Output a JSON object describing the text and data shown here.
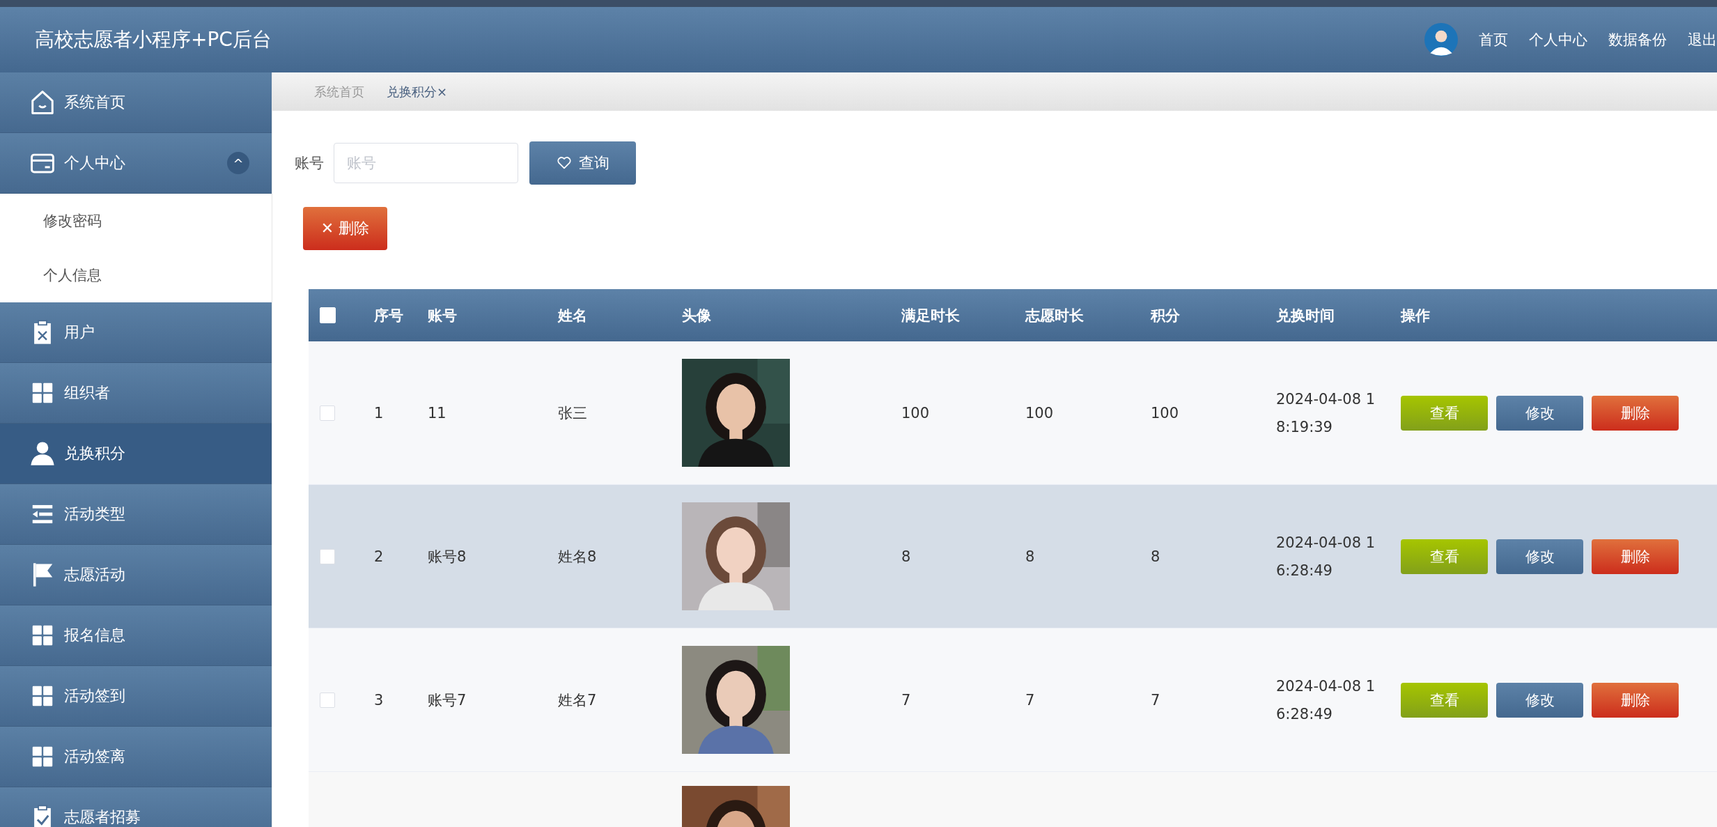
{
  "header": {
    "title": "高校志愿者小程序+PC后台",
    "nav": [
      "首页",
      "个人中心",
      "数据备份",
      "退出"
    ]
  },
  "sidebar": {
    "items": [
      {
        "label": "系统首页",
        "selected": false
      },
      {
        "label": "个人中心",
        "selected": false,
        "expanded": true,
        "toggle": "^",
        "children": [
          {
            "label": "修改密码",
            "selected": false
          },
          {
            "label": "个人信息",
            "selected": false
          }
        ]
      },
      {
        "label": "用户",
        "selected": false
      },
      {
        "label": "组织者",
        "selected": false
      },
      {
        "label": "兑换积分",
        "selected": true
      },
      {
        "label": "活动类型",
        "selected": false
      },
      {
        "label": "志愿活动",
        "selected": false
      },
      {
        "label": "报名信息",
        "selected": false
      },
      {
        "label": "活动签到",
        "selected": false
      },
      {
        "label": "活动签离",
        "selected": false
      },
      {
        "label": "志愿者招募",
        "selected": false
      }
    ]
  },
  "breadcrumb_tabs": [
    {
      "label": "系统首页",
      "selected": false
    },
    {
      "label": "兑换积分",
      "close": "×",
      "selected": true
    }
  ],
  "search": {
    "label": "账号",
    "placeholder": "账号",
    "button": "查询"
  },
  "delete_button": {
    "icon_char": "✕",
    "label": "删除"
  },
  "table": {
    "header_checked": false,
    "columns": [
      "序号",
      "账号",
      "姓名",
      "头像",
      "满足时长",
      "志愿时长",
      "积分",
      "兑换时间",
      "操作"
    ],
    "rows": [
      {
        "checked": false,
        "selected": false,
        "cells": [
          "1",
          "11",
          "张三"
        ],
        "avatar": {
          "kind": "picture"
        },
        "stats": [
          "100",
          "100",
          "100"
        ],
        "time": "2024-04-08 18:19:39",
        "actions": [
          "查看",
          "修改",
          "删除"
        ]
      },
      {
        "checked": false,
        "selected": true,
        "cells": [
          "2",
          "账号8",
          "姓名8"
        ],
        "avatar": {
          "kind": "picture"
        },
        "stats": [
          "8",
          "8",
          "8"
        ],
        "time": "2024-04-08 16:28:49",
        "actions": [
          "查看",
          "修改",
          "删除"
        ]
      },
      {
        "checked": false,
        "selected": false,
        "cells": [
          "3",
          "账号7",
          "姓名7"
        ],
        "avatar": {
          "kind": "picture"
        },
        "stats": [
          "7",
          "7",
          "7"
        ],
        "time": "2024-04-08 16:28:49",
        "actions": [
          "查看",
          "修改",
          "删除"
        ]
      },
      {
        "avatar": {
          "kind": "picture"
        }
      }
    ]
  }
}
